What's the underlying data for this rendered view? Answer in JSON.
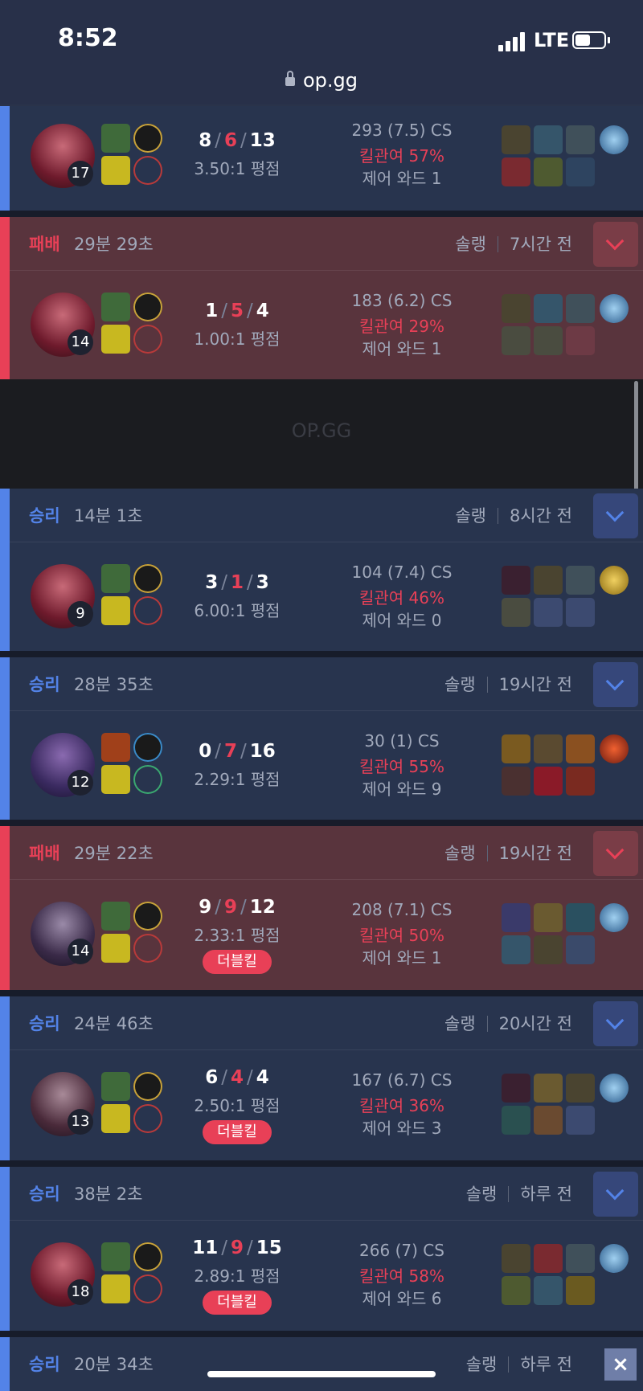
{
  "status_bar": {
    "time": "8:52",
    "network": "LTE"
  },
  "browser": {
    "url": "op.gg"
  },
  "ad": {
    "text": "OP.GG"
  },
  "close_label": "×",
  "matches": [
    {
      "result": "",
      "duration": "",
      "queue": "",
      "ago": "",
      "level": "17",
      "kills": "8",
      "deaths": "6",
      "assists": "13",
      "ratio": "3.50:1 평점",
      "cs": "293 (7.5) CS",
      "kp": "킬관여 57%",
      "ward": "제어 와드 1",
      "badge": "",
      "items": [
        "#4a4430",
        "#35556a",
        "#40505a",
        "#4a5f7a",
        "#7a2a30",
        "#4e5a30",
        "#2e4460"
      ]
    },
    {
      "result": "패배",
      "duration": "29분 29초",
      "queue": "솔랭",
      "ago": "7시간 전",
      "level": "14",
      "kills": "1",
      "deaths": "5",
      "assists": "4",
      "ratio": "1.00:1 평점",
      "cs": "183 (6.2) CS",
      "kp": "킬관여 29%",
      "ward": "제어 와드 1",
      "badge": "",
      "items": [
        "#4a4430",
        "#35556a",
        "#40505a",
        "#4a5f7a",
        "#4a4c40",
        "#4a4c40",
        ""
      ]
    },
    {
      "result": "승리",
      "duration": "14분 1초",
      "queue": "솔랭",
      "ago": "8시간 전",
      "level": "9",
      "kills": "3",
      "deaths": "1",
      "assists": "3",
      "ratio": "6.00:1 평점",
      "cs": "104 (7.4) CS",
      "kp": "킬관여 46%",
      "ward": "제어 와드 0",
      "badge": "",
      "items": [
        "#3a2030",
        "#4a4430",
        "#40505a",
        "#7a6a20",
        "#4a4c40",
        "",
        ""
      ]
    },
    {
      "result": "승리",
      "duration": "28분 35초",
      "queue": "솔랭",
      "ago": "19시간 전",
      "level": "12",
      "kills": "0",
      "deaths": "7",
      "assists": "16",
      "ratio": "2.29:1 평점",
      "cs": "30 (1) CS",
      "kp": "킬관여 55%",
      "ward": "제어 와드 9",
      "badge": "",
      "items": [
        "#7a5a20",
        "#5a4a30",
        "#8a5020",
        "#8a2a18",
        "#4a3030",
        "#8a1a28",
        "#7a2a20"
      ]
    },
    {
      "result": "패배",
      "duration": "29분 22초",
      "queue": "솔랭",
      "ago": "19시간 전",
      "level": "14",
      "kills": "9",
      "deaths": "9",
      "assists": "12",
      "ratio": "2.33:1 평점",
      "cs": "208 (7.1) CS",
      "kp": "킬관여 50%",
      "ward": "제어 와드 1",
      "badge": "더블킬",
      "items": [
        "#3a3a6a",
        "#6a5a30",
        "#2a5060",
        "#4a5f7a",
        "#35556a",
        "#4a4430",
        "#3a4a6a"
      ]
    },
    {
      "result": "승리",
      "duration": "24분 46초",
      "queue": "솔랭",
      "ago": "20시간 전",
      "level": "13",
      "kills": "6",
      "deaths": "4",
      "assists": "4",
      "ratio": "2.50:1 평점",
      "cs": "167 (6.7) CS",
      "kp": "킬관여 36%",
      "ward": "제어 와드 3",
      "badge": "더블킬",
      "items": [
        "#3a2030",
        "#6a5a30",
        "#4a4430",
        "#4a5f7a",
        "#2a5050",
        "#6a4a30",
        ""
      ]
    },
    {
      "result": "승리",
      "duration": "38분 2초",
      "queue": "솔랭",
      "ago": "하루 전",
      "level": "18",
      "kills": "11",
      "deaths": "9",
      "assists": "15",
      "ratio": "2.89:1 평점",
      "cs": "266 (7) CS",
      "kp": "킬관여 58%",
      "ward": "제어 와드 6",
      "badge": "더블킬",
      "items": [
        "#4a4430",
        "#7a2a30",
        "#40505a",
        "#4a5f7a",
        "#4e5a30",
        "#35556a",
        "#6a5a20"
      ]
    },
    {
      "result": "승리",
      "duration": "20분 34초",
      "queue": "솔랭",
      "ago": "하루 전"
    }
  ]
}
